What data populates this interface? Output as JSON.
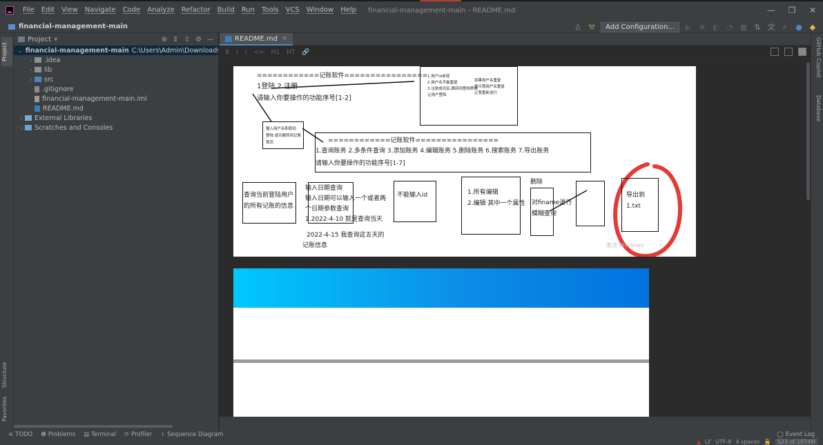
{
  "menu": [
    "File",
    "Edit",
    "View",
    "Navigate",
    "Code",
    "Analyze",
    "Refactor",
    "Build",
    "Run",
    "Tools",
    "VCS",
    "Window",
    "Help"
  ],
  "window_title": "financial-management-main - README.md",
  "window_controls": {
    "minimize": "—",
    "maximize": "❐",
    "close": "✕"
  },
  "navbar": {
    "project_name": "financial-management-main",
    "add_configuration": "Add Configuration..."
  },
  "left_strip": {
    "project": "Project",
    "structure": "Structure",
    "favorites": "Favorites"
  },
  "right_strip": {
    "copilot": "GitHub Copilot",
    "database": "Database"
  },
  "project_panel": {
    "title": "Project",
    "tree": [
      {
        "name": "financial-management-main",
        "path": "C:\\Users\\Admin\\Downloads\\financia",
        "indent": 0,
        "arrow": "⌄",
        "icon": "folder-blue",
        "selected": true
      },
      {
        "name": ".idea",
        "indent": 1,
        "arrow": "›",
        "icon": "folder"
      },
      {
        "name": "lib",
        "indent": 1,
        "arrow": "›",
        "icon": "folder"
      },
      {
        "name": "src",
        "indent": 1,
        "arrow": "›",
        "icon": "folder-src"
      },
      {
        "name": ".gitignore",
        "indent": 1,
        "arrow": "",
        "icon": "file"
      },
      {
        "name": "financial-management-main.iml",
        "indent": 1,
        "arrow": "",
        "icon": "iml"
      },
      {
        "name": "README.md",
        "indent": 1,
        "arrow": "",
        "icon": "md"
      },
      {
        "name": "External Libraries",
        "indent": 0,
        "arrow": "›",
        "icon": "lib"
      },
      {
        "name": "Scratches and Consoles",
        "indent": 0,
        "arrow": "›",
        "icon": "scratch"
      }
    ]
  },
  "editor": {
    "tab": "README.md",
    "toolbar_items": [
      "B",
      "I",
      "I",
      "<>",
      "H1",
      "HT",
      "🔗"
    ]
  },
  "diagram": {
    "header1": "============记账软件================",
    "menu1": "1登陆 2.注册",
    "prompt1": "请输入你要操作的功能序号[1-2]",
    "note_register": [
      "1.用户id自增",
      "2.用户名不能重复",
      "3.注册成功后,跳回到登陆界面",
      "让用户登陆"
    ],
    "note_register2": [
      "如果用户名重复",
      "提示我用户名重复",
      "让我重新进行"
    ],
    "note_login": [
      "输入用户名和密码",
      "登陆 成功跳转到记账",
      "首页"
    ],
    "header2": "============记账软件================",
    "menu2": "1.查询账务 2.多条件查询 3.添加账务 4.编辑账务 5.删除账务 6.搜索账务 7.导出账务",
    "prompt2": "请输入你要操作的功能序号[1-7]",
    "box_query": [
      "查询当前登陆用户",
      "的所有记账的信息"
    ],
    "box_multi": [
      "输入日期查询",
      "输入日期可以输入一个或者两",
      "个日期参数查询",
      "1.2022-4-10 就是查询当天",
      "2022-4-15 我查询这五天的",
      "记账信息"
    ],
    "box_add": "不能输入id",
    "box_edit": [
      "1.所有编辑",
      "2.编辑 其中一个属性"
    ],
    "box_delete_label": "删除",
    "box_search": [
      "对finame进行",
      "模糊查询"
    ],
    "box_export": [
      "导出到",
      "1.txt"
    ],
    "watermark": "激活 Windows"
  },
  "bottom_tools": [
    {
      "icon": "≡",
      "label": "TODO"
    },
    {
      "icon": "❶",
      "label": "Problems"
    },
    {
      "icon": "▤",
      "label": "Terminal"
    },
    {
      "icon": "⟳",
      "label": "Profiler"
    },
    {
      "icon": "⇂",
      "label": "Sequence Diagram"
    }
  ],
  "event_log": "Event Log",
  "status": {
    "line_ending": "LF",
    "encoding": "UTF-8",
    "indent": "4 spaces",
    "memory": "523 of 1974M"
  },
  "colors": {
    "accent": "#4a88c7",
    "selection": "#0d293e",
    "background": "#2b2b2b",
    "panel": "#3c3f41",
    "red_circle": "#e53935"
  }
}
